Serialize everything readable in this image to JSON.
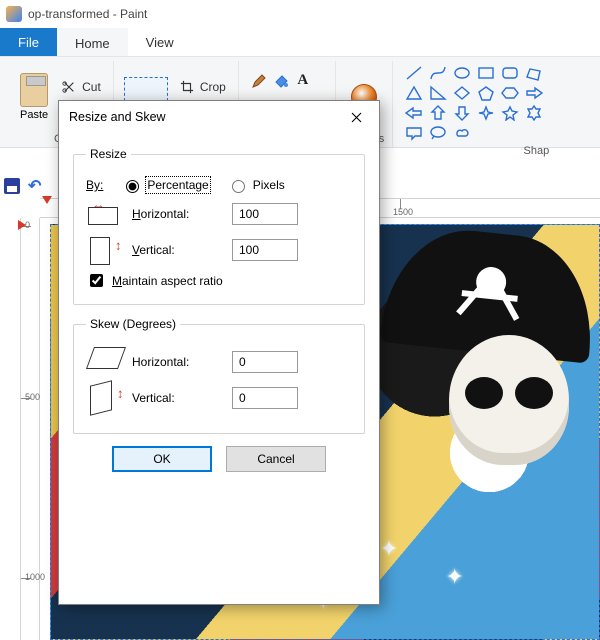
{
  "window": {
    "title": "op-transformed - Paint"
  },
  "tabs": {
    "file": "File",
    "home": "Home",
    "view": "View"
  },
  "ribbon": {
    "clipboard": {
      "label": "Cli",
      "paste": "Paste",
      "cut": "Cut"
    },
    "image": {
      "crop": "Crop"
    },
    "brushes": {
      "label": "Brushes"
    },
    "shapes": {
      "label": "Shap"
    }
  },
  "ruler": {
    "h_major": "1500",
    "v_500": "500",
    "v_1000": "1000",
    "origin": "0"
  },
  "dialog": {
    "title": "Resize and Skew",
    "close_aria": "Close",
    "resize": {
      "legend": "Resize",
      "by_label": "By:",
      "percentage": "Percentage",
      "pixels": "Pixels",
      "horizontal": "Horizontal:",
      "h_hot": "H",
      "vertical": "Vertical:",
      "v_hot": "V",
      "h_value": "100",
      "v_value": "100",
      "maintain": "Maintain aspect ratio",
      "m_hot": "M"
    },
    "skew": {
      "legend": "Skew (Degrees)",
      "horizontal": "Horizontal:",
      "vertical": "Vertical:",
      "h_value": "0",
      "v_value": "0"
    },
    "ok": "OK",
    "cancel": "Cancel"
  }
}
